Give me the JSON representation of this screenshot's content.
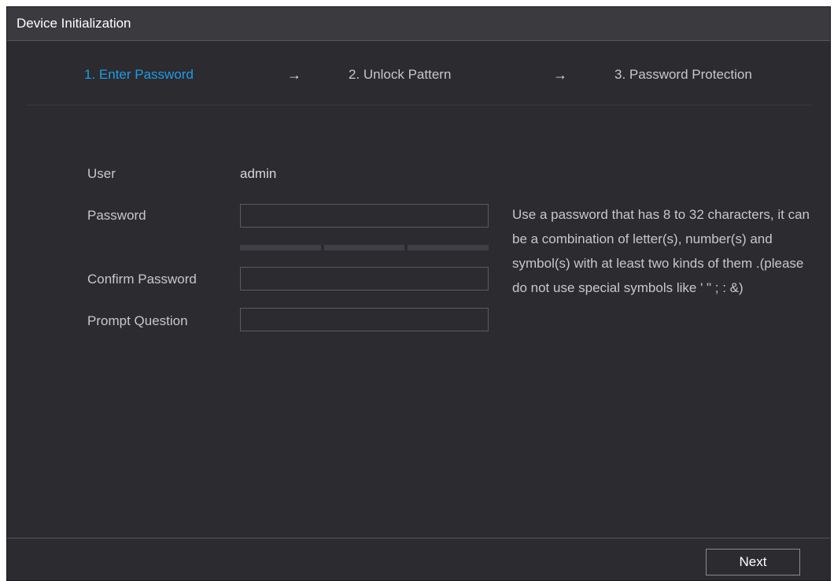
{
  "window": {
    "title": "Device Initialization"
  },
  "steps": [
    {
      "label": "1.  Enter Password",
      "active": true
    },
    {
      "label": "2.  Unlock Pattern",
      "active": false
    },
    {
      "label": "3.  Password Protection",
      "active": false
    }
  ],
  "step_arrow": "→",
  "form": {
    "user_label": "User",
    "user_value": "admin",
    "password_label": "Password",
    "password_value": "",
    "confirm_label": "Confirm Password",
    "confirm_value": "",
    "prompt_label": "Prompt Question",
    "prompt_value": ""
  },
  "hint": "Use a password that has 8 to 32 characters, it can be a combination of letter(s), number(s) and symbol(s) with at least two kinds of them .(please do not use special symbols like ' \" ; : &)",
  "footer": {
    "next_label": "Next"
  },
  "colors": {
    "background": "#2b2b30",
    "titlebar": "#3a3a3f",
    "active_step": "#1e9ce6",
    "text": "#c8c8c8"
  }
}
